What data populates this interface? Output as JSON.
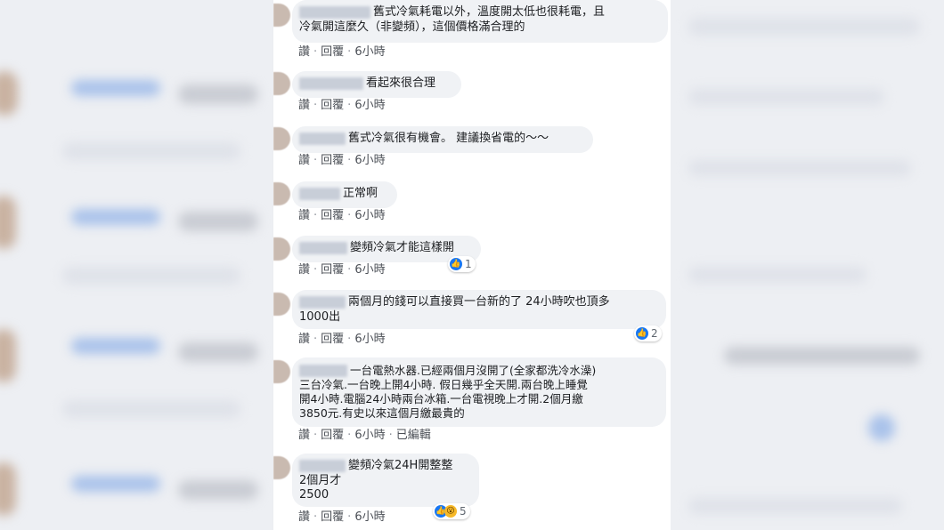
{
  "comments": [
    {
      "text": "舊式冷氣耗電以外，溫度開太低也很耗電，且\n冷氣開這麼久（非變頻），這個價格滿合理的",
      "actions": [
        "讚",
        "回覆",
        "6小時"
      ],
      "reactions": null
    },
    {
      "text": "看起來很合理",
      "actions": [
        "讚",
        "回覆",
        "6小時"
      ],
      "reactions": null
    },
    {
      "text": "舊式冷氣很有機會。 建議換省電的～～",
      "actions": [
        "讚",
        "回覆",
        "6小時"
      ],
      "reactions": null
    },
    {
      "text": "正常啊",
      "actions": [
        "讚",
        "回覆",
        "6小時"
      ],
      "reactions": null
    },
    {
      "text": "變頻冷氣才能這樣開",
      "actions": [
        "讚",
        "回覆",
        "6小時"
      ],
      "reactions": {
        "types": [
          "like-icon"
        ],
        "count": "1"
      }
    },
    {
      "text": "兩個月的錢可以直接買一台新的了 24小時吹也頂多\n1000出",
      "actions": [
        "讚",
        "回覆",
        "6小時"
      ],
      "reactions": {
        "types": [
          "like-icon"
        ],
        "count": "2"
      }
    },
    {
      "text": "一台電熱水器.已經兩個月沒開了(全家都洗冷水澡)\n三台冷氣.一台晚上開4小時. 假日幾乎全天開.兩台晚上睡覺\n開4小時.電腦24小時兩台冰箱.一台電視晚上才開.2個月繳\n3850元.有史以來這個月繳最貴的",
      "actions": [
        "讚",
        "回覆",
        "6小時",
        "已編輯"
      ],
      "reactions": null
    },
    {
      "text": "變頻冷氣24H開整整\n2個月才\n2500",
      "actions": [
        "讚",
        "回覆",
        "6小時"
      ],
      "reactions": {
        "types": [
          "like-icon",
          "wow-icon"
        ],
        "count": "5"
      }
    }
  ],
  "colors": {
    "bubble_bg": "#f0f2f5",
    "like_blue": "#1877f2",
    "wow_yellow": "#f7b928",
    "action_text": "#4b4f56"
  }
}
